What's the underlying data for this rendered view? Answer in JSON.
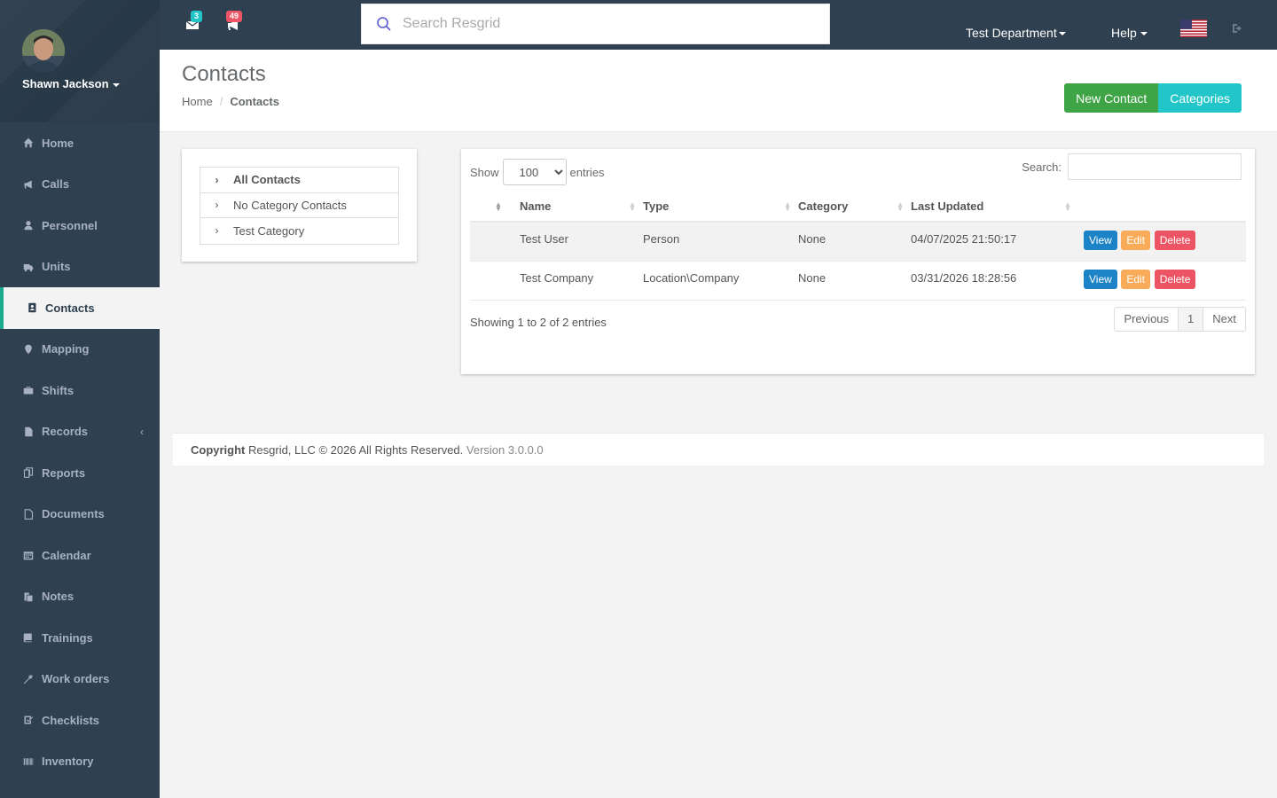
{
  "user": {
    "name": "Shawn Jackson"
  },
  "sidebar": {
    "items": [
      {
        "label": "Home",
        "icon": "home-icon"
      },
      {
        "label": "Calls",
        "icon": "bullhorn-icon"
      },
      {
        "label": "Personnel",
        "icon": "user-icon"
      },
      {
        "label": "Units",
        "icon": "truck-icon"
      },
      {
        "label": "Contacts",
        "icon": "address-book-icon",
        "active": true
      },
      {
        "label": "Mapping",
        "icon": "map-marker-icon"
      },
      {
        "label": "Shifts",
        "icon": "briefcase-icon"
      },
      {
        "label": "Records",
        "icon": "file-icon",
        "arrow": "‹"
      },
      {
        "label": "Reports",
        "icon": "report-icon"
      },
      {
        "label": "Documents",
        "icon": "document-icon"
      },
      {
        "label": "Calendar",
        "icon": "calendar-icon"
      },
      {
        "label": "Notes",
        "icon": "notes-icon"
      },
      {
        "label": "Trainings",
        "icon": "book-icon"
      },
      {
        "label": "Work orders",
        "icon": "wrench-icon"
      },
      {
        "label": "Checklists",
        "icon": "checklist-icon"
      },
      {
        "label": "Inventory",
        "icon": "barcode-icon"
      }
    ]
  },
  "topbar": {
    "messages_count": "3",
    "calls_count": "49",
    "search_placeholder": "Search Resgrid",
    "department": "Test Department",
    "help": "Help"
  },
  "page": {
    "title": "Contacts",
    "breadcrumb_home": "Home",
    "breadcrumb_current": "Contacts",
    "new_contact_label": "New Contact",
    "categories_label": "Categories"
  },
  "categories": [
    {
      "label": "All Contacts"
    },
    {
      "label": "No Category Contacts"
    },
    {
      "label": "Test Category"
    }
  ],
  "table": {
    "show_label": "Show",
    "entries_label": "entries",
    "page_size": "100",
    "search_label": "Search:",
    "columns": [
      "Name",
      "Type",
      "Category",
      "Last Updated"
    ],
    "rows": [
      {
        "name": "Test User",
        "type": "Person",
        "category": "None",
        "updated": "04/07/2025 21:50:17"
      },
      {
        "name": "Test Company",
        "type": "Location\\Company",
        "category": "None",
        "updated": "03/31/2026 18:28:56"
      }
    ],
    "actions": {
      "view": "View",
      "edit": "Edit",
      "delete": "Delete"
    },
    "info": "Showing 1 to 2 of 2 entries",
    "prev": "Previous",
    "page": "1",
    "next": "Next"
  },
  "footer": {
    "copyright_label": "Copyright",
    "copyright_text": "Resgrid, LLC © 2026 All Rights Reserved.",
    "version": "Version 3.0.0.0"
  },
  "colors": {
    "sidebar_bg": "#2f4050",
    "accent_green": "#3ea445",
    "accent_teal": "#23c6c8",
    "view_blue": "#1c84c6",
    "edit_orange": "#f8ac59",
    "delete_red": "#ed5565"
  }
}
